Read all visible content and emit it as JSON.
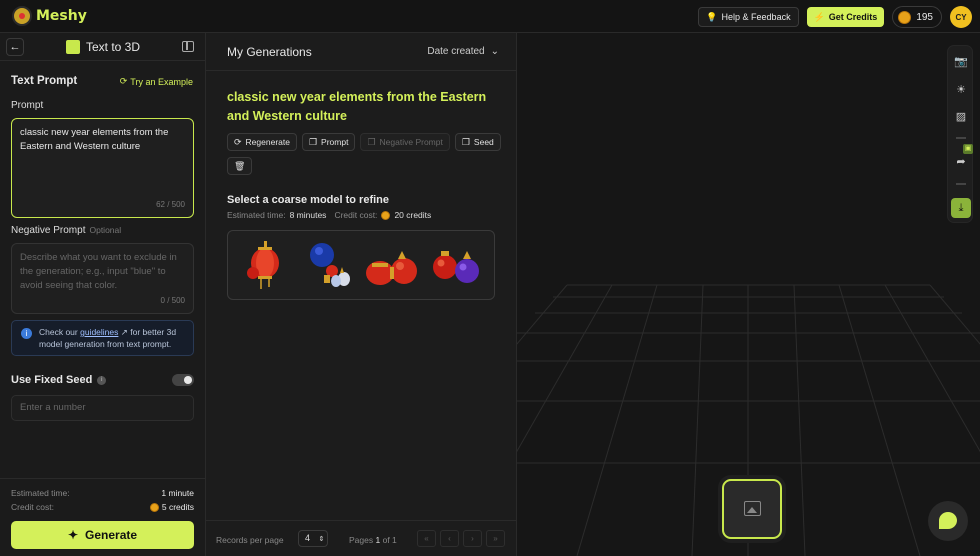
{
  "topbar": {
    "brand": "Meshy",
    "help_label": "Help & Feedback",
    "get_credits_label": "Get Credits",
    "credits_count": "195",
    "avatar_initials": "CY"
  },
  "left_panel": {
    "mode_title": "Text to 3D",
    "section_title": "Text Prompt",
    "try_example": "Try an Example",
    "prompt_label": "Prompt",
    "prompt_value": "classic new year elements from the Eastern and Western culture",
    "prompt_counter": "62 / 500",
    "negative_label": "Negative Prompt",
    "negative_optional": "Optional",
    "negative_placeholder": "Describe what you want to exclude in the generation; e.g., input \"blue\" to avoid seeing that color.",
    "negative_counter": "0 / 500",
    "info_prefix": "Check our ",
    "info_link": "guidelines",
    "info_suffix": " for better 3d model generation from text prompt.",
    "seed_label": "Use Fixed Seed",
    "seed_placeholder": "Enter a number",
    "estimated_time_label": "Estimated time:",
    "estimated_time_value": "1 minute",
    "credit_cost_label": "Credit cost:",
    "credit_cost_value": "5 credits",
    "generate_label": "Generate"
  },
  "middle_panel": {
    "title": "My Generations",
    "sort_label": "Date created",
    "generation_title": "classic new year elements from the Eastern and Western culture",
    "chips": {
      "regenerate": "Regenerate",
      "prompt": "Prompt",
      "negative_prompt": "Negative Prompt",
      "seed": "Seed"
    },
    "select_title": "Select a coarse model to refine",
    "est_time_label": "Estimated time:",
    "est_time_value": "8 minutes",
    "credit_cost_label": "Credit cost:",
    "credit_cost_value": "20 credits",
    "records_per_page_label": "Records per page",
    "records_per_page_value": "4",
    "pages_label": "Pages",
    "pages_current": "1",
    "pages_of": "of 1"
  },
  "colors": {
    "accent": "#d4f05a",
    "background": "#141414",
    "panel": "#1b1b1b"
  }
}
